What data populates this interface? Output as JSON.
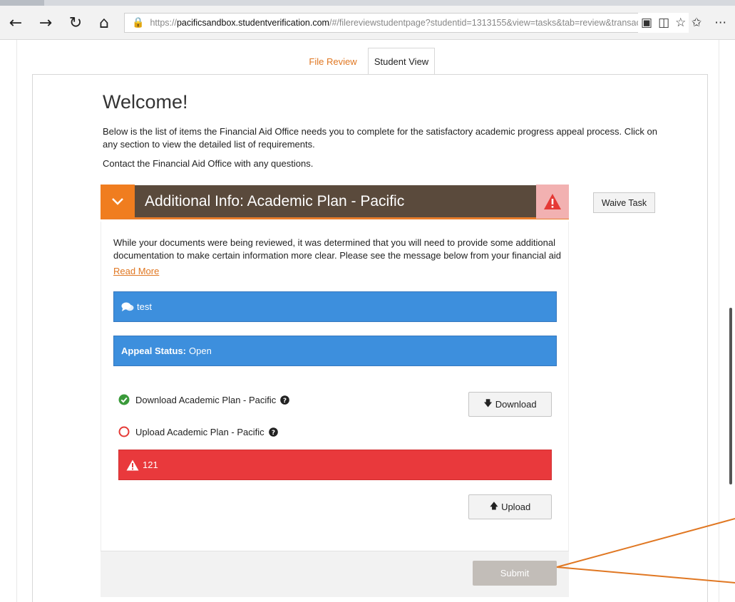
{
  "browser": {
    "url_protocol": "https://",
    "url_domain": "pacificsandbox.studentverification.com",
    "url_path": "/#/filereviewstudentpage?studentid=1313155&view=tasks&tab=review&transactiong",
    "icons": {
      "back": "back-arrow-icon",
      "forward": "forward-arrow-icon",
      "refresh": "refresh-icon",
      "home": "home-icon",
      "lock": "lock-icon",
      "tracking": "tracking-prevention-icon",
      "reading": "reading-view-icon",
      "favorite": "star-icon",
      "favorites_bar": "favorites-icon",
      "more": "more-icon"
    }
  },
  "tabs": [
    {
      "label": "File Review",
      "active": false
    },
    {
      "label": "Student View",
      "active": true
    }
  ],
  "welcome": {
    "title": "Welcome!",
    "intro": "Below is the list of items the Financial Aid Office needs you to complete for the satisfactory academic progress appeal process. Click on any section to view the detailed list of requirements.",
    "contact": "Contact the Financial Aid Office with any questions."
  },
  "task": {
    "title": "Additional Info: Academic Plan - Pacific",
    "waive_label": "Waive Task",
    "description": "While your documents were being reviewed, it was determined that you will need to provide some additional documentation to make certain information more clear. Please see the message below from your financial aid",
    "read_more": "Read More",
    "message": "test",
    "status_label": "Appeal Status:",
    "status_value": "Open",
    "requirements": {
      "download_label": "Download Academic Plan - Pacific",
      "download_button": "Download",
      "upload_label": "Upload Academic Plan - Pacific",
      "upload_button": "Upload",
      "error_text": "121"
    },
    "submit_label": "Submit"
  },
  "colors": {
    "accent": "#f07d1f",
    "header_bg": "#5a4a3c",
    "info_blue": "#3d8fdd",
    "error_red": "#e9393c",
    "success_green": "#3a9a3a"
  }
}
